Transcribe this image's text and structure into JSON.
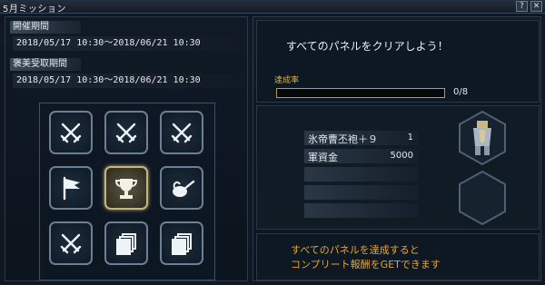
{
  "window": {
    "title": "5月ミッション",
    "help_label": "?",
    "close_label": "✕"
  },
  "left": {
    "period_label": "開催期間",
    "period_value": "2018/05/17 10:30～2018/06/21 10:30",
    "claim_label": "褒美受取期間",
    "claim_value": "2018/05/17 10:30～2018/06/21 10:30",
    "panels": [
      {
        "icon": "crossed-swords-icon"
      },
      {
        "icon": "crossed-swords-icon"
      },
      {
        "icon": "crossed-swords-icon"
      },
      {
        "icon": "flag-icon"
      },
      {
        "icon": "trophy-icon",
        "selected": true
      },
      {
        "icon": "watering-can-icon"
      },
      {
        "icon": "crossed-swords-icon"
      },
      {
        "icon": "cards-icon"
      },
      {
        "icon": "cards-icon"
      }
    ]
  },
  "right": {
    "objective": "すべてのパネルをクリアしよう！",
    "progress_label": "達成率",
    "progress_text": "0/8",
    "progress_fraction": 0,
    "rewards": [
      {
        "name": "氷帝曹丕袍＋９",
        "qty": "1"
      },
      {
        "name": "軍資金",
        "qty": "5000"
      },
      {
        "name": "",
        "qty": ""
      },
      {
        "name": "",
        "qty": ""
      },
      {
        "name": "",
        "qty": ""
      }
    ],
    "note_line1": "すべてのパネルを達成すると",
    "note_line2": "コンプリート報酬をGETできます"
  },
  "colors": {
    "accent_gold": "#d9b34a",
    "note_orange": "#e3a53a"
  }
}
